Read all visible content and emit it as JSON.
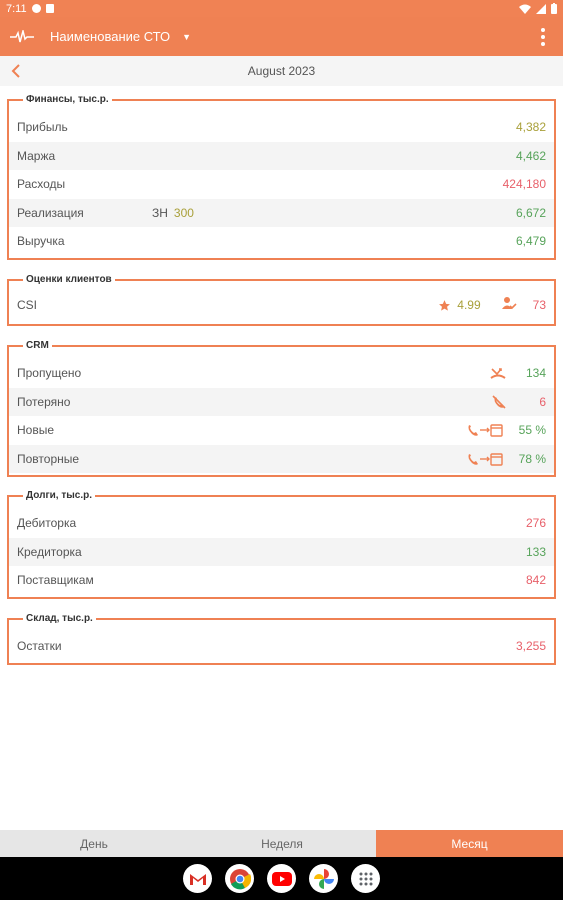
{
  "status_bar": {
    "time": "7:11"
  },
  "app_bar": {
    "title": "Наименование СТО"
  },
  "date_bar": {
    "label": "August 2023"
  },
  "finance": {
    "legend": "Финансы, тыс.р.",
    "rows": [
      {
        "label": "Прибыль",
        "value": "4,382",
        "color": "olive"
      },
      {
        "label": "Маржа",
        "value": "4,462",
        "color": "green"
      },
      {
        "label": "Расходы",
        "value": "424,180",
        "color": "red"
      },
      {
        "label": "Реализация",
        "extra_label": "ЗН",
        "extra_value": "300",
        "value": "6,672",
        "color": "green"
      },
      {
        "label": "Выручка",
        "value": "6,479",
        "color": "green"
      }
    ]
  },
  "ratings": {
    "legend": "Оценки клиентов",
    "csi_label": "CSI",
    "csi_score": "4.99",
    "csi_count": "73"
  },
  "crm": {
    "legend": "CRM",
    "rows": [
      {
        "label": "Пропущено",
        "value": "134",
        "color": "green",
        "icon": "missed-call-icon"
      },
      {
        "label": "Потеряно",
        "value": "6",
        "color": "red",
        "icon": "lost-call-icon"
      },
      {
        "label": "Новые",
        "value": "55 %",
        "color": "green",
        "icon": "call-to-calendar-icon"
      },
      {
        "label": "Повторные",
        "value": "78 %",
        "color": "green",
        "icon": "call-to-calendar-icon"
      }
    ]
  },
  "debts": {
    "legend": "Долги, тыс.р.",
    "rows": [
      {
        "label": "Дебиторка",
        "value": "276",
        "color": "red"
      },
      {
        "label": "Кредиторка",
        "value": "133",
        "color": "green"
      },
      {
        "label": "Поставщикам",
        "value": "842",
        "color": "red"
      }
    ]
  },
  "warehouse": {
    "legend": "Склад, тыс.р.",
    "rows": [
      {
        "label": "Остатки",
        "value": "3,255",
        "color": "red"
      }
    ]
  },
  "tabs": [
    {
      "label": "День",
      "active": false
    },
    {
      "label": "Неделя",
      "active": false
    },
    {
      "label": "Месяц",
      "active": true
    }
  ],
  "colors": {
    "accent": "#ef8153",
    "green": "#57a35a",
    "red": "#e8606a",
    "olive": "#a9a03a"
  },
  "dock_apps": [
    "gmail-icon",
    "chrome-icon",
    "youtube-icon",
    "photos-icon",
    "app-drawer-icon"
  ]
}
